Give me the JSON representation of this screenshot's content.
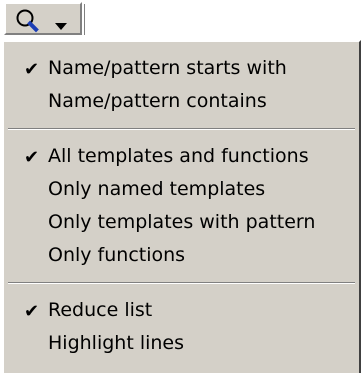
{
  "toolbar": {
    "search_icon": "magnifier-icon",
    "dropdown_icon": "dropdown-arrow-icon"
  },
  "menu": {
    "groups": [
      {
        "items": [
          {
            "label": "Name/pattern starts with",
            "checked": true
          },
          {
            "label": "Name/pattern contains",
            "checked": false
          }
        ]
      },
      {
        "items": [
          {
            "label": "All templates and functions",
            "checked": true
          },
          {
            "label": "Only named templates",
            "checked": false
          },
          {
            "label": "Only templates with pattern",
            "checked": false
          },
          {
            "label": "Only functions",
            "checked": false
          }
        ]
      },
      {
        "items": [
          {
            "label": "Reduce list",
            "checked": true
          },
          {
            "label": "Highlight lines",
            "checked": false
          }
        ]
      }
    ]
  },
  "colors": {
    "menu_bg": "#d4d0c8",
    "icon_blue": "#1a3db5"
  }
}
